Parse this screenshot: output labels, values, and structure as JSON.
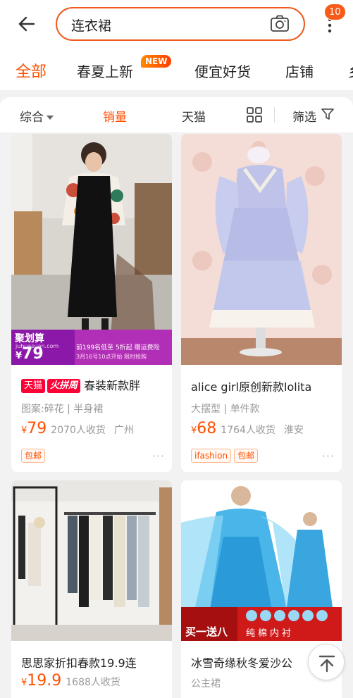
{
  "header": {
    "back_icon": "arrow-left-icon",
    "search_value": "连衣裙",
    "camera_icon": "camera-icon",
    "more_icon": "more-vertical-icon",
    "badge_count": "10"
  },
  "tabs": [
    {
      "label": "全部",
      "active": true
    },
    {
      "label": "春夏上新",
      "tag": "NEW"
    },
    {
      "label": "便宜好货"
    },
    {
      "label": "店铺"
    },
    {
      "label": "乡"
    }
  ],
  "sort": {
    "items": [
      "综合",
      "销量",
      "天猫"
    ],
    "filter_label": "筛选",
    "grid_icon": "grid-view-icon",
    "filter_icon": "filter-icon"
  },
  "products": [
    {
      "image_desc": "girl in floral shirt and black overall dress",
      "promo": {
        "brand": "聚划算",
        "brand_url": "juhuasuan.com",
        "price": "79",
        "line1": "前199名低至 5折起  赠运费险",
        "line2": "3月16号10点开始  限时抢购"
      },
      "badges": [
        "天猫",
        "火拼周"
      ],
      "title": "春装新款胖",
      "attrs": "图案:碎花 | 半身裙",
      "yen": "¥",
      "price": "79",
      "sales": "2070人收货",
      "location": "广州",
      "tags": [
        "包邮"
      ],
      "more": "···"
    },
    {
      "image_desc": "lavender lolita dress on mannequin",
      "title": "alice girl原创新款lolita",
      "attrs": "大摆型 | 单件款",
      "yen": "¥",
      "price": "68",
      "sales": "1764人收货",
      "location": "淮安",
      "tags": [
        "ifashion",
        "包邮"
      ],
      "more": "···"
    },
    {
      "image_desc": "clothing racks in boutique",
      "title": "思思家折扣春款19.9连",
      "attrs": "",
      "yen": "¥",
      "price": "19.9",
      "sales": "1688人收货",
      "location": ""
    },
    {
      "image_desc": "two girls in blue princess dresses",
      "promo_banner": "买一送八",
      "promo_sub": "纯棉内衬",
      "title": "冰雪奇缘秋冬爱沙公",
      "attrs": "公主裙"
    }
  ],
  "back_to_top_icon": "arrow-up-icon",
  "colors": {
    "accent": "#ff5000",
    "tmall": "#ff0036"
  }
}
